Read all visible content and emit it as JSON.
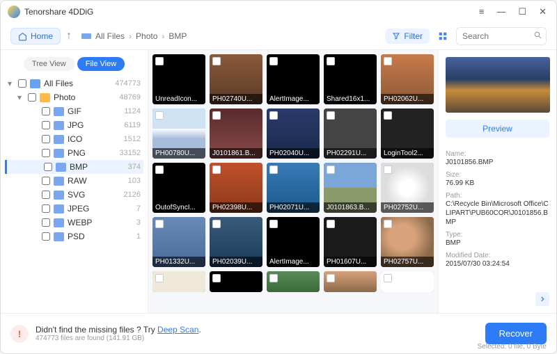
{
  "app_title": "Tenorshare 4DDiG",
  "toolbar": {
    "home": "Home",
    "filter": "Filter",
    "search_placeholder": "Search"
  },
  "breadcrumb": [
    "All Files",
    "Photo",
    "BMP"
  ],
  "tabs": {
    "tree": "Tree View",
    "file": "File View"
  },
  "tree": {
    "all": {
      "label": "All Files",
      "count": "474773"
    },
    "photo": {
      "label": "Photo",
      "count": "48769"
    },
    "children": [
      {
        "label": "GIF",
        "count": "1124"
      },
      {
        "label": "JPG",
        "count": "6119"
      },
      {
        "label": "ICO",
        "count": "1512"
      },
      {
        "label": "PNG",
        "count": "33152"
      },
      {
        "label": "BMP",
        "count": "374",
        "sel": true
      },
      {
        "label": "RAW",
        "count": "103"
      },
      {
        "label": "SVG",
        "count": "2126"
      },
      {
        "label": "JPEG",
        "count": "7"
      },
      {
        "label": "WEBP",
        "count": "3"
      },
      {
        "label": "PSD",
        "count": "1"
      }
    ]
  },
  "thumbs": [
    {
      "name": "UnreadIcon..."
    },
    {
      "name": "PH02740U..."
    },
    {
      "name": "AlertImage..."
    },
    {
      "name": "Shared16x1..."
    },
    {
      "name": "PH02062U..."
    },
    {
      "name": "PH00780U..."
    },
    {
      "name": "J0101861.B..."
    },
    {
      "name": "PH02040U..."
    },
    {
      "name": "PH02291U..."
    },
    {
      "name": "LoginTool2..."
    },
    {
      "name": "OutofSyncI..."
    },
    {
      "name": "PH02398U..."
    },
    {
      "name": "PH02071U..."
    },
    {
      "name": "J0101863.B..."
    },
    {
      "name": "PH02752U..."
    },
    {
      "name": "PH01332U..."
    },
    {
      "name": "PH02039U..."
    },
    {
      "name": "AlertImage..."
    },
    {
      "name": "PH01607U..."
    },
    {
      "name": "PH02757U..."
    },
    {
      "name": ""
    },
    {
      "name": ""
    },
    {
      "name": ""
    },
    {
      "name": ""
    },
    {
      "name": ""
    }
  ],
  "thumb_art": [
    "#000",
    "linear-gradient(#8a5a3a,#5a3a2a)",
    "#000",
    "#000",
    "linear-gradient(#c87a4a,#8a5a3a)",
    "linear-gradient(180deg,#cfe2f3 40%,#fff 40%,#a7bedb 60%)",
    "linear-gradient(#5a2a2a,#8a4a4a)",
    "linear-gradient(180deg,#2a3a6a,#1a2a4a)",
    "#444",
    "#222",
    "#000",
    "linear-gradient(#c0502a,#8a3a1a)",
    "linear-gradient(#3a7ab8,#1a5a8a)",
    "linear-gradient(180deg,#7aa7d8 50%,#8a9a6a 50%)",
    "radial-gradient(circle at 50% 50%,#fff 20%,#ddd 60%)",
    "linear-gradient(180deg,#6a8ab8,#4a6a9a)",
    "linear-gradient(180deg,#3a5a7a,#1a3a5a)",
    "#000",
    "#1a1a1a",
    "radial-gradient(ellipse at 40% 40%,#d8a27a 30%,#8a6a4a 70%)",
    "#f0e8d8",
    "#000",
    "linear-gradient(180deg,#5a8a5a,#3a6a3a)",
    "linear-gradient(180deg,#d8a27a,#8a6a4a)",
    "#fff"
  ],
  "detail": {
    "preview_btn": "Preview",
    "name_lbl": "Name:",
    "name": "J0101856.BMP",
    "size_lbl": "Size:",
    "size": "76.99 KB",
    "path_lbl": "Path:",
    "path": "C:\\Recycle Bin\\Microsoft Office\\CLIPART\\PUB60COR\\J0101856.BMP",
    "type_lbl": "Type:",
    "type": "BMP",
    "mod_lbl": "Modified Date:",
    "mod": "2015/07/30 03:24:54"
  },
  "footer": {
    "line1_a": "Didn't find the missing files ? Try ",
    "line1_link": "Deep Scan",
    "line1_b": ".",
    "line2": "474773 files are found (141.91 GB)",
    "recover": "Recover",
    "selected": "Selected: 0 file, 0 Byte"
  }
}
